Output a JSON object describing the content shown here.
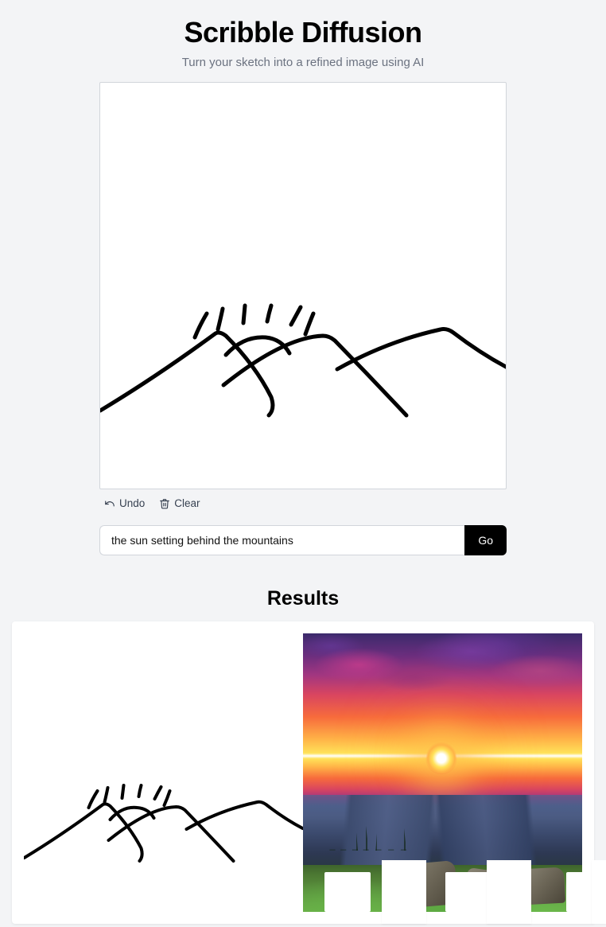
{
  "header": {
    "title": "Scribble Diffusion",
    "subtitle": "Turn your sketch into a refined image using AI"
  },
  "canvas": {
    "undo_label": "Undo",
    "clear_label": "Clear",
    "undo_icon": "undo-icon",
    "clear_icon": "trash-icon"
  },
  "prompt": {
    "value": "the sun setting behind the mountains",
    "go_label": "Go"
  },
  "results": {
    "heading": "Results"
  }
}
